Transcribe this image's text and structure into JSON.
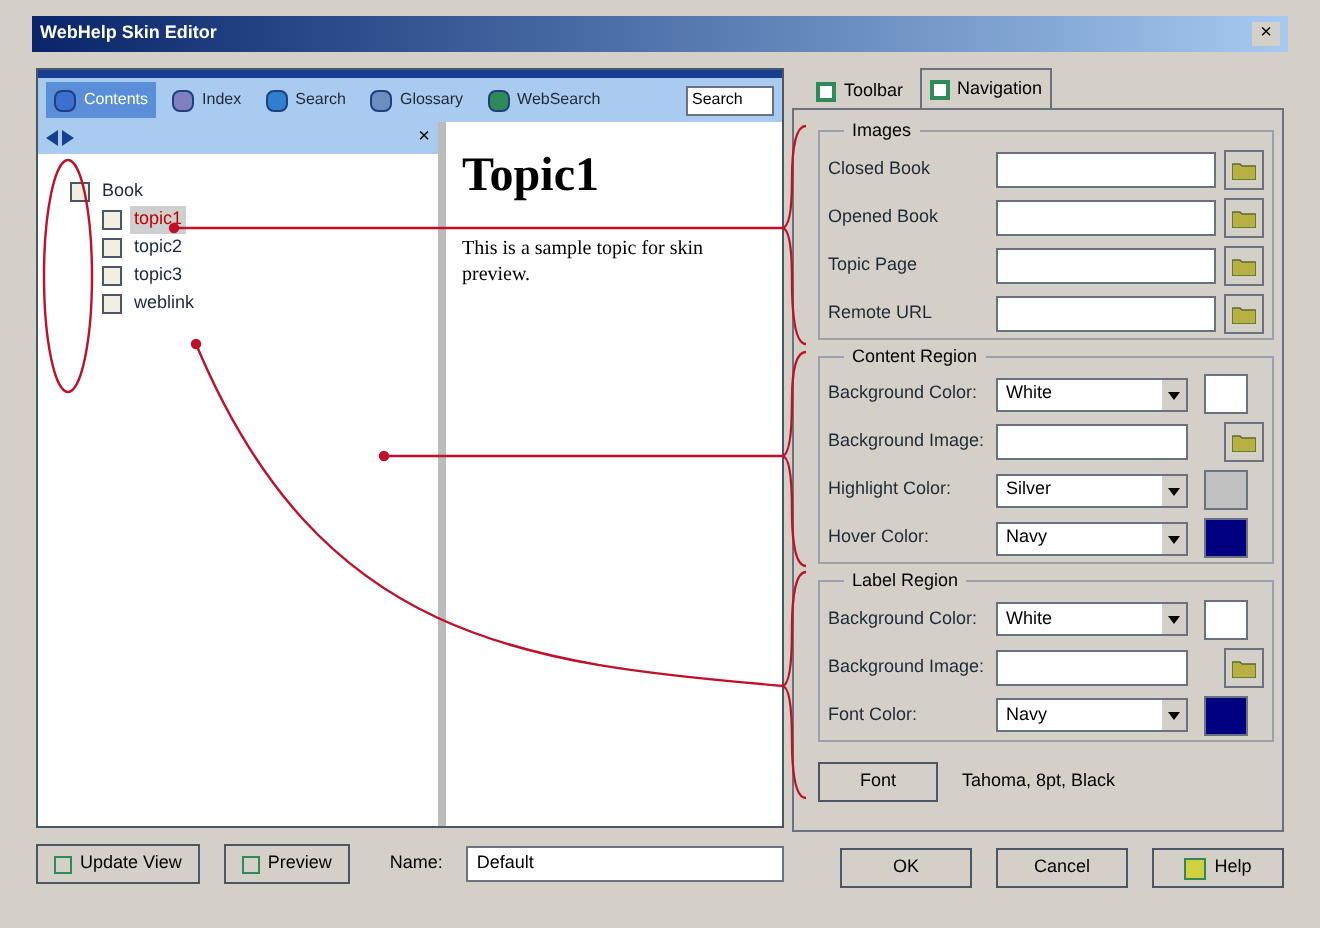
{
  "window": {
    "title": "WebHelp Skin Editor",
    "close": "×"
  },
  "preview": {
    "tabs": [
      {
        "label": "Contents",
        "selected": true
      },
      {
        "label": "Index",
        "selected": false
      },
      {
        "label": "Search",
        "selected": false
      },
      {
        "label": "Glossary",
        "selected": false
      },
      {
        "label": "WebSearch",
        "selected": false
      }
    ],
    "search_value": "Search",
    "pane_close": "×",
    "tree": [
      {
        "label": "Book",
        "children": [
          {
            "label": "topic1",
            "selected": true
          },
          {
            "label": "topic2",
            "selected": false
          },
          {
            "label": "topic3",
            "selected": false
          },
          {
            "label": "weblink",
            "selected": false
          }
        ]
      }
    ],
    "topic": {
      "heading": "Topic1",
      "body": "This is a sample topic for skin preview."
    }
  },
  "bottom": {
    "buttons": [
      "Update View",
      "Preview"
    ],
    "name_label": "Name:",
    "name_value": "Default"
  },
  "settings": {
    "tabs": [
      {
        "label": "Toolbar",
        "selected": false
      },
      {
        "label": "Navigation",
        "selected": true
      }
    ],
    "groups": [
      {
        "title": "Images",
        "rows": [
          {
            "kind": "file",
            "label": "Closed Book"
          },
          {
            "kind": "file",
            "label": "Opened Book"
          },
          {
            "kind": "file",
            "label": "Topic Page"
          },
          {
            "kind": "file",
            "label": "Remote URL"
          }
        ]
      },
      {
        "title": "Content Region",
        "rows": [
          {
            "kind": "color",
            "label": "Background Color:",
            "value": "White",
            "color": "#ffffff"
          },
          {
            "kind": "file",
            "label": "Background Image:"
          },
          {
            "kind": "color",
            "label": "Highlight Color:",
            "value": "Silver",
            "color": "#c0c0c0"
          },
          {
            "kind": "color",
            "label": "Hover Color:",
            "value": "Navy",
            "color": "#000080"
          }
        ]
      },
      {
        "title": "Label Region",
        "rows": [
          {
            "kind": "color",
            "label": "Background Color:",
            "value": "White",
            "color": "#ffffff"
          },
          {
            "kind": "file",
            "label": "Background Image:"
          },
          {
            "kind": "color",
            "label": "Font Color:",
            "value": "Navy",
            "color": "#000080"
          }
        ]
      }
    ],
    "font_button": "Font",
    "font_value": "Tahoma, 8pt, Black"
  },
  "dialog_buttons": [
    "OK",
    "Cancel",
    "Help"
  ]
}
